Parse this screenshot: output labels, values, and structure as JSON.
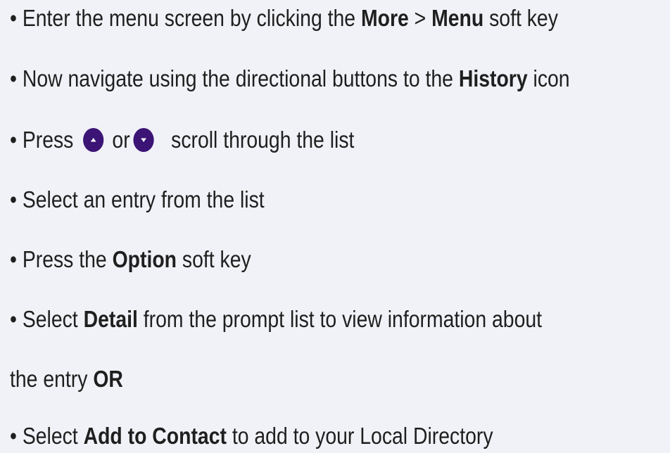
{
  "instructions": {
    "line1": {
      "p1": "• Enter the menu screen by clicking the ",
      "b1": "More",
      "p2": " > ",
      "b2": "Menu",
      "p3": " soft key"
    },
    "line2": {
      "p1": "• Now navigate using the directional buttons to the ",
      "b1": "History",
      "p2": " icon"
    },
    "line3": {
      "p1": "• Press",
      "up_icon": "up-arrow-button-icon",
      "p2": "or",
      "down_icon": "down-arrow-button-icon",
      "p3": "scroll through the list"
    },
    "line4": {
      "p1": "• Select an entry from the list"
    },
    "line5": {
      "p1": "• Press the ",
      "b1": "Option",
      "p2": " soft key"
    },
    "line6": {
      "p1": "• Select ",
      "b1": "Detail",
      "p2": " from the prompt list to view information about"
    },
    "line7": {
      "p1": "the entry ",
      "b1": "OR"
    },
    "line8": {
      "p1": "• Select ",
      "b1": "Add to Contact",
      "p2": " to add to your Local Directory"
    }
  },
  "colors": {
    "background": "#f1f2f7",
    "text": "#1f1f1f",
    "button_icon": "#3b1476"
  }
}
